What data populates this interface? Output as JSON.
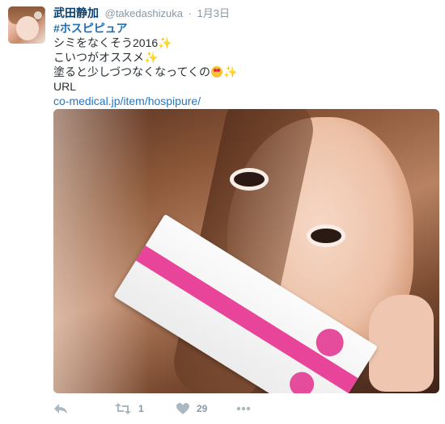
{
  "tweet": {
    "display_name": "武田静加",
    "handle": "@takedashizuka",
    "separator": "·",
    "timestamp": "1月3日",
    "hashtag": "#ホスピピュア",
    "lines": [
      "シミをなくそう2016",
      "こいつがオススメ",
      "塗ると少しづつなくなってくの",
      "URL"
    ],
    "sparkle_emoji": "✨",
    "link": "co-medical.jp/item/hospipure/"
  },
  "actions": {
    "reply_icon": "reply-icon",
    "retweet_icon": "retweet-icon",
    "retweet_count": "1",
    "like_icon": "heart-icon",
    "like_count": "29",
    "more_icon": "more-icon"
  },
  "colors": {
    "name": "#0b3f6e",
    "meta": "#8899a6",
    "link": "#1f78c8",
    "action": "#aab8c2"
  }
}
